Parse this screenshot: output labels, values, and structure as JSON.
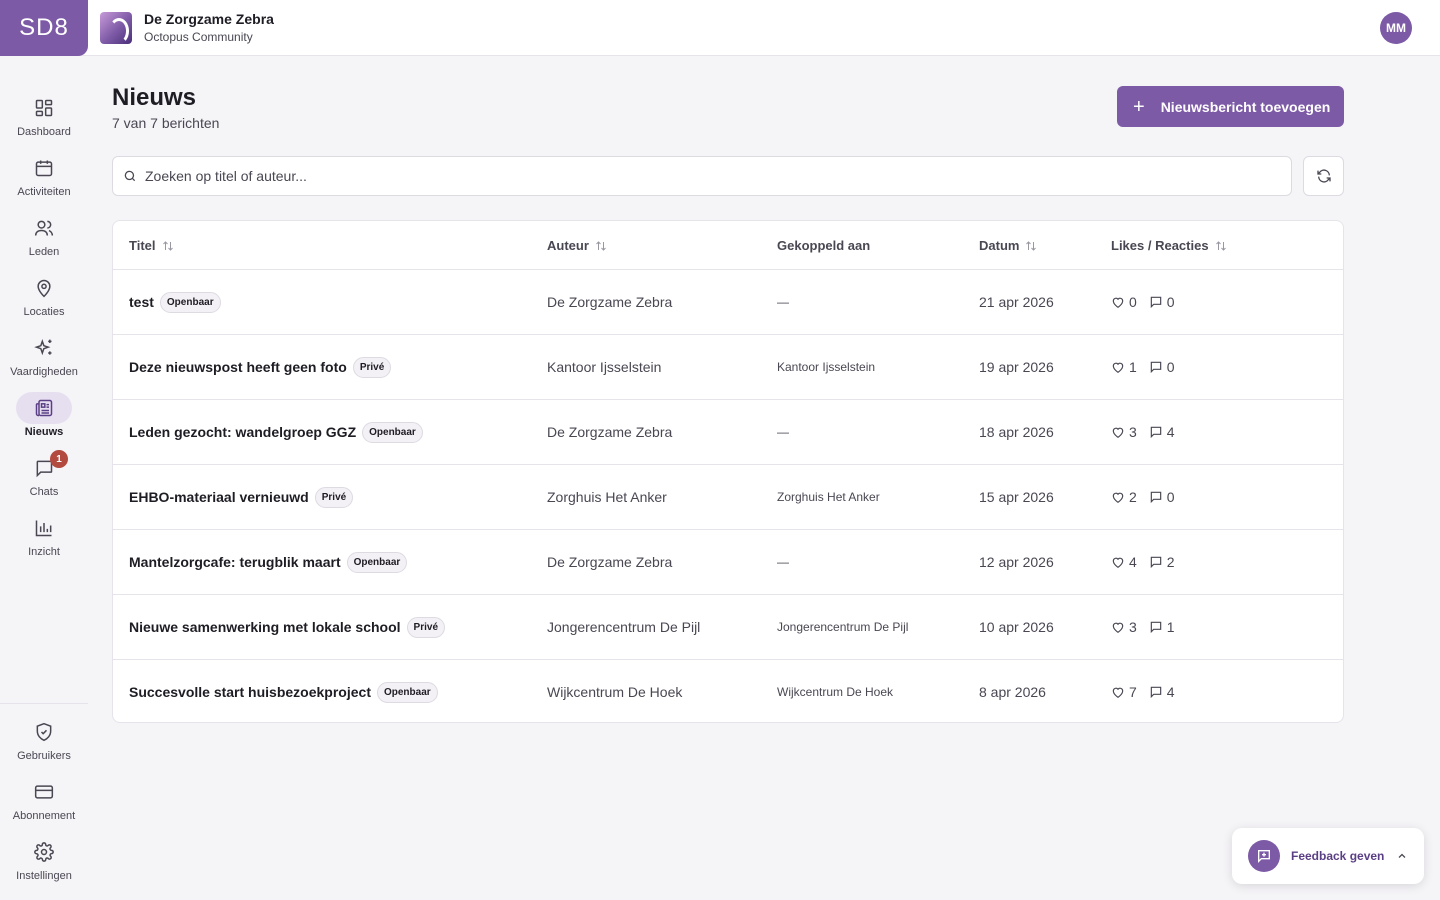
{
  "brand": {
    "logo_text": "SD8",
    "accent": "#7d5aa6"
  },
  "org": {
    "name": "De Zorgzame Zebra",
    "subtitle": "Octopus Community"
  },
  "user": {
    "initials": "MM"
  },
  "sidebar": {
    "items": [
      {
        "label": "Dashboard",
        "icon": "dashboard-icon"
      },
      {
        "label": "Activiteiten",
        "icon": "calendar-icon"
      },
      {
        "label": "Leden",
        "icon": "users-icon"
      },
      {
        "label": "Locaties",
        "icon": "map-pin-icon"
      },
      {
        "label": "Vaardigheden",
        "icon": "sparkles-icon"
      },
      {
        "label": "Nieuws",
        "icon": "newspaper-icon",
        "active": true
      },
      {
        "label": "Chats",
        "icon": "chat-icon",
        "badge": "1"
      },
      {
        "label": "Inzicht",
        "icon": "bar-chart-icon"
      }
    ],
    "bottom_items": [
      {
        "label": "Gebruikers",
        "icon": "shield-check-icon"
      },
      {
        "label": "Abonnement",
        "icon": "credit-card-icon"
      },
      {
        "label": "Instellingen",
        "icon": "gear-icon"
      }
    ]
  },
  "page": {
    "title": "Nieuws",
    "subtitle": "7 van 7 berichten",
    "add_button": "Nieuwsbericht toevoegen"
  },
  "search": {
    "placeholder": "Zoeken op titel of auteur..."
  },
  "table": {
    "columns": [
      "Titel",
      "Auteur",
      "Gekoppeld aan",
      "Datum",
      "Likes / Reacties"
    ],
    "rows": [
      {
        "title": "test",
        "visibility": "Openbaar",
        "author": "De Zorgzame Zebra",
        "linked": "—",
        "date": "21 apr 2026",
        "likes": "0",
        "comments": "0"
      },
      {
        "title": "Deze nieuwspost heeft geen foto",
        "visibility": "Privé",
        "author": "Kantoor Ijsselstein",
        "linked": "Kantoor Ijsselstein",
        "date": "19 apr 2026",
        "likes": "1",
        "comments": "0"
      },
      {
        "title": "Leden gezocht: wandelgroep GGZ",
        "visibility": "Openbaar",
        "author": "De Zorgzame Zebra",
        "linked": "—",
        "date": "18 apr 2026",
        "likes": "3",
        "comments": "4"
      },
      {
        "title": "EHBO-materiaal vernieuwd",
        "visibility": "Privé",
        "author": "Zorghuis Het Anker",
        "linked": "Zorghuis Het Anker",
        "date": "15 apr 2026",
        "likes": "2",
        "comments": "0"
      },
      {
        "title": "Mantelzorgcafe: terugblik maart",
        "visibility": "Openbaar",
        "author": "De Zorgzame Zebra",
        "linked": "—",
        "date": "12 apr 2026",
        "likes": "4",
        "comments": "2"
      },
      {
        "title": "Nieuwe samenwerking met lokale school",
        "visibility": "Privé",
        "author": "Jongerencentrum De Pijl",
        "linked": "Jongerencentrum De Pijl",
        "date": "10 apr 2026",
        "likes": "3",
        "comments": "1"
      },
      {
        "title": "Succesvolle start huisbezoekproject",
        "visibility": "Openbaar",
        "author": "Wijkcentrum De Hoek",
        "linked": "Wijkcentrum De Hoek",
        "date": "8 apr 2026",
        "likes": "7",
        "comments": "4"
      }
    ]
  },
  "feedback": {
    "label": "Feedback geven"
  }
}
